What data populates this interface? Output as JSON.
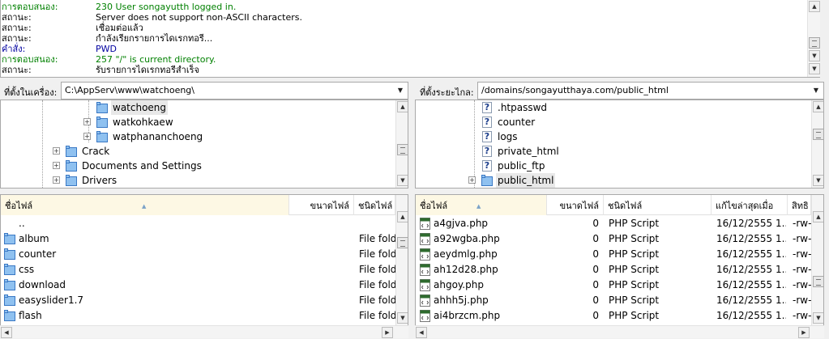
{
  "log": {
    "lines": [
      {
        "label": "การตอบสนอง:",
        "message": "230 User songayutth logged in.",
        "color": "green"
      },
      {
        "label": "สถานะ:",
        "message": "Server does not support non-ASCII characters.",
        "color": "black"
      },
      {
        "label": "สถานะ:",
        "message": "เชื่อมต่อแล้ว",
        "color": "black"
      },
      {
        "label": "สถานะ:",
        "message": "กำลังเรียกรายการไดเรกทอรี...",
        "color": "black"
      },
      {
        "label": "คำสั่ง:",
        "message": "PWD",
        "color": "blue"
      },
      {
        "label": "การตอบสนอง:",
        "message": "257 \"/\" is current directory.",
        "color": "green"
      },
      {
        "label": "สถานะ:",
        "message": "รับรายการไดเรกทอรีสำเร็จ",
        "color": "black"
      }
    ]
  },
  "local": {
    "address_label": "ที่ตั้งในเครื่อง:",
    "path": "C:\\AppServ\\www\\watchoeng\\",
    "tree": [
      {
        "label": "watchoeng",
        "selected": true
      },
      {
        "label": "watkohkaew",
        "selected": false
      },
      {
        "label": "watphananchoeng",
        "selected": false
      },
      {
        "label": "Crack",
        "selected": false
      },
      {
        "label": "Documents and Settings",
        "selected": false
      },
      {
        "label": "Drivers",
        "selected": false
      }
    ],
    "columns": {
      "name": "ชื่อไฟล์",
      "size": "ขนาดไฟล์",
      "type": "ชนิดไฟล์"
    },
    "files": [
      {
        "name": "..",
        "type": ""
      },
      {
        "name": "album",
        "type": "File folder"
      },
      {
        "name": "counter",
        "type": "File folder"
      },
      {
        "name": "css",
        "type": "File folder"
      },
      {
        "name": "download",
        "type": "File folder"
      },
      {
        "name": "easyslider1.7",
        "type": "File folder"
      },
      {
        "name": "flash",
        "type": "File folder"
      }
    ]
  },
  "remote": {
    "address_label": "ที่ตั้งระยะไกล:",
    "path": "/domains/songayutthaya.com/public_html",
    "tree": [
      {
        "label": ".htpasswd",
        "selected": false
      },
      {
        "label": "counter",
        "selected": false
      },
      {
        "label": "logs",
        "selected": false
      },
      {
        "label": "private_html",
        "selected": false
      },
      {
        "label": "public_ftp",
        "selected": false
      },
      {
        "label": "public_html",
        "selected": true
      }
    ],
    "columns": {
      "name": "ชื่อไฟล์",
      "size": "ขนาดไฟล์",
      "type": "ชนิดไฟล์",
      "modified": "แก้ไขล่าสุดเมื่อ",
      "perm": "สิทธิ"
    },
    "files": [
      {
        "name": "a4gjva.php",
        "size": "0",
        "type": "PHP Script",
        "modified": "16/12/2555 1...",
        "perm": "-rw-"
      },
      {
        "name": "a92wgba.php",
        "size": "0",
        "type": "PHP Script",
        "modified": "16/12/2555 1...",
        "perm": "-rw-"
      },
      {
        "name": "aeydmlg.php",
        "size": "0",
        "type": "PHP Script",
        "modified": "16/12/2555 1...",
        "perm": "-rw-"
      },
      {
        "name": "ah12d28.php",
        "size": "0",
        "type": "PHP Script",
        "modified": "16/12/2555 1...",
        "perm": "-rw-"
      },
      {
        "name": "ahgoy.php",
        "size": "0",
        "type": "PHP Script",
        "modified": "16/12/2555 1...",
        "perm": "-rw-"
      },
      {
        "name": "ahhh5j.php",
        "size": "0",
        "type": "PHP Script",
        "modified": "16/12/2555 1...",
        "perm": "-rw-"
      },
      {
        "name": "ai4brzcm.php",
        "size": "0",
        "type": "PHP Script",
        "modified": "16/12/2555 1...",
        "perm": "-rw-"
      }
    ]
  },
  "icons": {
    "folder": "folder-icon",
    "php": "php-file-icon",
    "unknown": "question-icon",
    "expand": "plus-expander-icon"
  },
  "colors": {
    "response": "#008000",
    "command": "#0000a0",
    "folder_blue": "#4a8fd8"
  }
}
